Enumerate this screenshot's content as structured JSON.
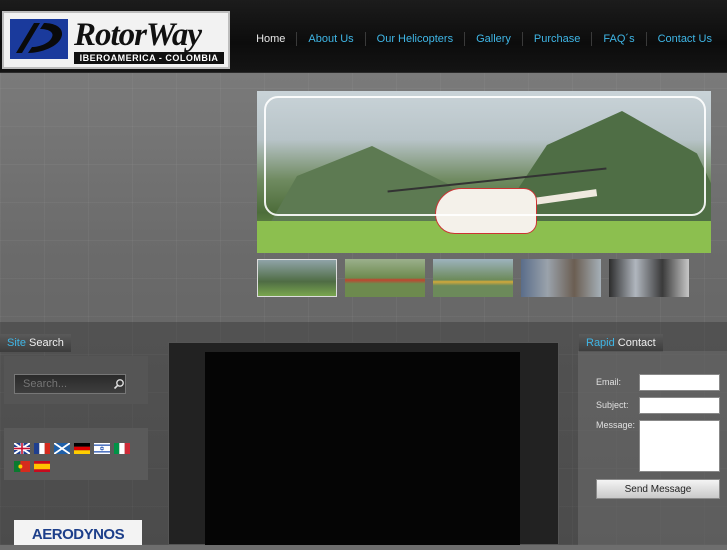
{
  "header": {
    "logo_word": "RotorWay",
    "logo_sub": "IBEROAMERICA - COLOMBIA",
    "nav": [
      {
        "label": "Home",
        "active": true
      },
      {
        "label": "About Us"
      },
      {
        "label": "Our Helicopters"
      },
      {
        "label": "Gallery"
      },
      {
        "label": "Purchase"
      },
      {
        "label": "FAQ´s"
      },
      {
        "label": "Contact Us"
      }
    ]
  },
  "site_search": {
    "title_highlight": "Site",
    "title_rest": " Search",
    "placeholder": "Search...",
    "icon": "search-icon"
  },
  "languages": [
    {
      "name": "english-flag",
      "colors": [
        "#1f3f8f",
        "#ffffff",
        "#c8102e"
      ]
    },
    {
      "name": "french-flag",
      "colors": [
        "#1f3f8f",
        "#ffffff",
        "#d52b1e"
      ]
    },
    {
      "name": "scotland-flag",
      "colors": [
        "#1e5fa8",
        "#ffffff"
      ]
    },
    {
      "name": "german-flag",
      "colors": [
        "#000000",
        "#dd0000",
        "#ffce00"
      ]
    },
    {
      "name": "israel-flag",
      "colors": [
        "#ffffff",
        "#2a57b3"
      ]
    },
    {
      "name": "italian-flag",
      "colors": [
        "#009246",
        "#ffffff",
        "#ce2b37"
      ]
    },
    {
      "name": "portugal-flag",
      "colors": [
        "#0a7a2f",
        "#d52b1e"
      ]
    },
    {
      "name": "spanish-flag",
      "colors": [
        "#c60b1e",
        "#ffc400"
      ]
    }
  ],
  "sponsor": {
    "label": "AERODYNOS"
  },
  "gallery": {
    "thumbs": [
      "thumb-1",
      "thumb-2",
      "thumb-3",
      "thumb-4",
      "thumb-5"
    ]
  },
  "rapid_contact": {
    "title_highlight": "Rapid",
    "title_rest": " Contact",
    "email_label": "Email:",
    "subject_label": "Subject:",
    "message_label": "Message:",
    "send_label": "Send Message"
  },
  "colors": {
    "accent": "#3fb6e6",
    "header_bg": "#111111"
  }
}
